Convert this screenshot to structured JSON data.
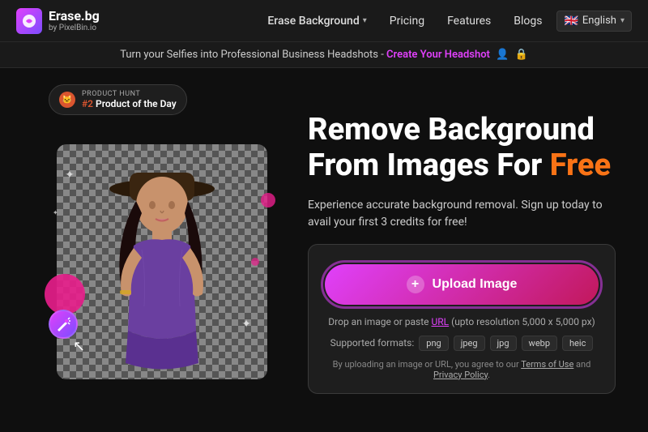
{
  "navbar": {
    "logo_main": "Erase.bg",
    "logo_sub": "by PixelBin.io",
    "nav_erase_label": "Erase Background",
    "nav_pricing_label": "Pricing",
    "nav_features_label": "Features",
    "nav_blogs_label": "Blogs",
    "nav_lang_label": "English",
    "nav_lang_flag": "🇬🇧"
  },
  "announcement": {
    "text": "Turn your Selfies into Professional Business Headshots - ",
    "link_text": "Create Your Headshot",
    "icon1": "👤",
    "icon2": "🔒"
  },
  "product_hunt": {
    "badge_label": "PRODUCT HUNT",
    "rank": "#2",
    "rank_label": "Product of the Day"
  },
  "hero": {
    "headline_line1": "Remove Background",
    "headline_line2": "From Images For ",
    "headline_free": "Free",
    "subheadline": "Experience accurate background removal. Sign up today to avail your first 3 credits for free!"
  },
  "upload": {
    "button_label": "Upload Image",
    "drop_hint_before": "Drop an image or paste ",
    "drop_hint_url": "URL",
    "drop_hint_after": " (upto resolution 5,000 x 5,000 px)",
    "formats_label": "Supported formats:",
    "format_png": "png",
    "format_jpeg": "jpeg",
    "format_jpg": "jpg",
    "format_webp": "webp",
    "format_heic": "heic",
    "terms_before": "By uploading an image or URL, you agree to our ",
    "terms_of_use": "Terms of Use",
    "terms_and": " and ",
    "privacy_policy": "Privacy Policy",
    "terms_dot": "."
  },
  "colors": {
    "accent": "#e040fb",
    "orange": "#f97316",
    "bg_dark": "#0f0f0f",
    "bg_card": "#1e1e1e"
  }
}
